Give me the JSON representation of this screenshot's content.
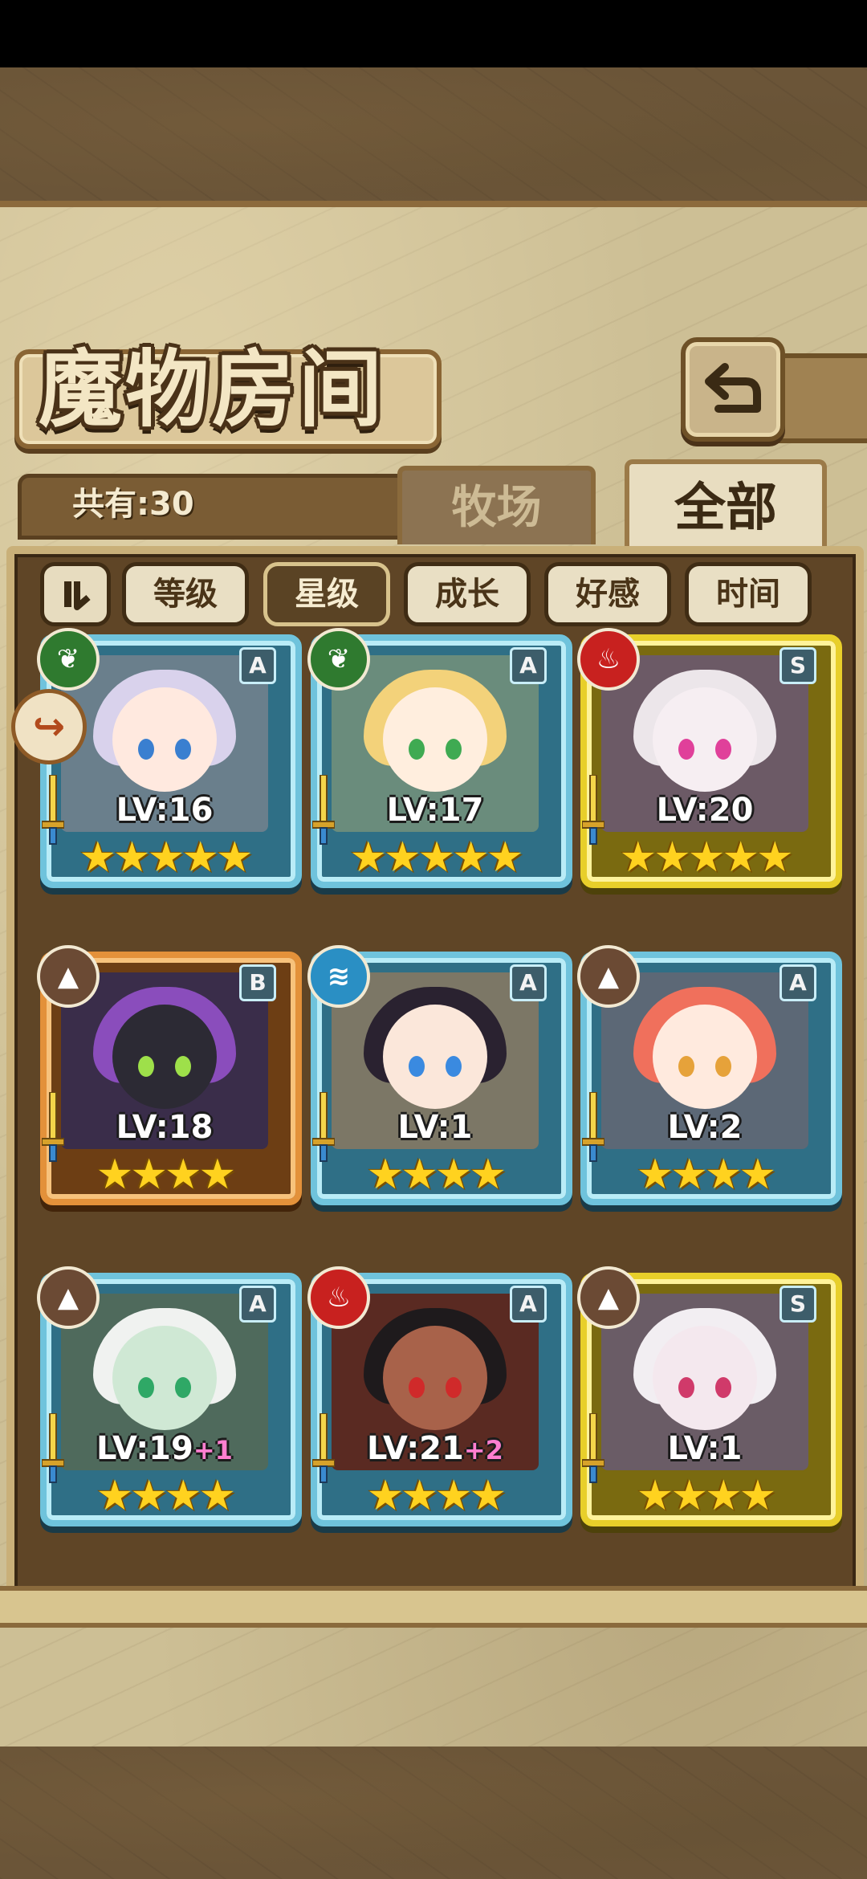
{
  "title": "魔物房间",
  "count_label": "共有:30",
  "tabs": [
    {
      "label": "牧场",
      "active": false
    },
    {
      "label": "全部",
      "active": true
    }
  ],
  "sort_buttons": [
    {
      "label": "等级",
      "active": false
    },
    {
      "label": "星级",
      "active": true
    },
    {
      "label": "成长",
      "active": false
    },
    {
      "label": "好感",
      "active": false
    },
    {
      "label": "时间",
      "active": false
    }
  ],
  "icons": {
    "back": "back-arrow-icon",
    "sort_order": "sort-order-icon",
    "favorite": "favorite-marker-icon"
  },
  "cards": [
    {
      "element": "leaf",
      "rarity": "A",
      "level": "LV:16",
      "bonus": "",
      "stars": 5,
      "portrait": {
        "bg": "#6a7f8c",
        "hair": "#d9d2ec",
        "skin": "#ffe9df",
        "eye": "#3a7fd0"
      }
    },
    {
      "element": "leaf",
      "rarity": "A",
      "level": "LV:17",
      "bonus": "",
      "stars": 5,
      "portrait": {
        "bg": "#6a8c7c",
        "hair": "#f3d27a",
        "skin": "#ffeede",
        "eye": "#3faa52"
      }
    },
    {
      "element": "fire",
      "rarity": "S",
      "level": "LV:20",
      "bonus": "",
      "stars": 5,
      "portrait": {
        "bg": "#6c5a66",
        "hair": "#ece6ea",
        "skin": "#f6eef2",
        "eye": "#e0409a"
      }
    },
    {
      "element": "earth",
      "rarity": "B",
      "level": "LV:18",
      "bonus": "",
      "stars": 4,
      "portrait": {
        "bg": "#3a2d4a",
        "hair": "#8a4dbc",
        "skin": "#2c2a34",
        "eye": "#9ee04a"
      }
    },
    {
      "element": "water",
      "rarity": "A",
      "level": "LV:1",
      "bonus": "",
      "stars": 4,
      "portrait": {
        "bg": "#7c7766",
        "hair": "#2a2230",
        "skin": "#fbe7da",
        "eye": "#3a8ae0"
      }
    },
    {
      "element": "earth",
      "rarity": "A",
      "level": "LV:2",
      "bonus": "",
      "stars": 4,
      "portrait": {
        "bg": "#5c6876",
        "hair": "#f0705c",
        "skin": "#ffeade",
        "eye": "#e6a23a"
      }
    },
    {
      "element": "earth",
      "rarity": "A",
      "level": "LV:19",
      "bonus": "+1",
      "stars": 4,
      "portrait": {
        "bg": "#4f6a5c",
        "hair": "#f0f2f0",
        "skin": "#cfe8d4",
        "eye": "#2fa866"
      }
    },
    {
      "element": "fire",
      "rarity": "A",
      "level": "LV:21",
      "bonus": "+2",
      "stars": 4,
      "portrait": {
        "bg": "#5a2a22",
        "hair": "#1e1a1c",
        "skin": "#a8624a",
        "eye": "#d02a2a"
      }
    },
    {
      "element": "earth",
      "rarity": "S",
      "level": "LV:1",
      "bonus": "",
      "stars": 4,
      "portrait": {
        "bg": "#6a5c66",
        "hair": "#f2eef2",
        "skin": "#f4e8ee",
        "eye": "#d03a6a"
      }
    }
  ]
}
